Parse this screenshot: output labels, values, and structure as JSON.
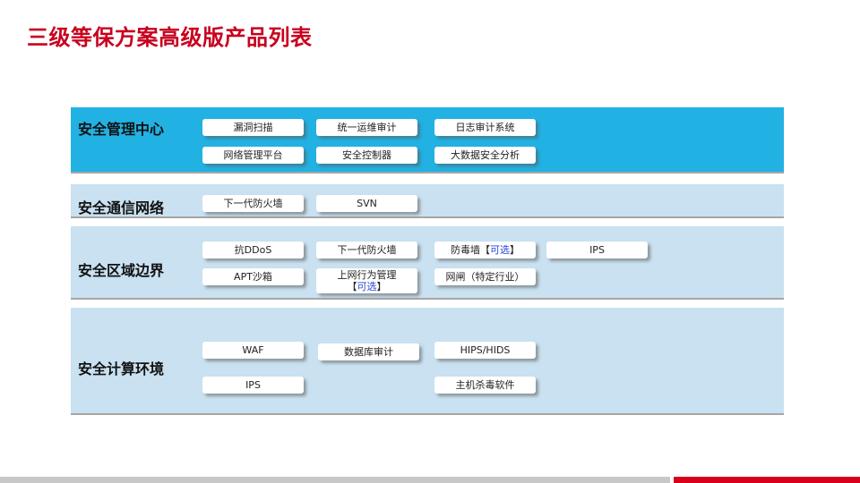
{
  "title": "三级等保方案高级版产品列表",
  "colors": {
    "title": "#c8001e",
    "section_primary": "#22b1e3",
    "section_secondary": "#c9e1f0",
    "optional_text": "#2a45d4",
    "footer_accent": "#d9001b"
  },
  "sections": [
    {
      "label": "安全管理中心",
      "products": [
        "漏洞扫描",
        "统一运维审计",
        "日志审计系统",
        "网络管理平台",
        "安全控制器",
        "大数据安全分析"
      ]
    },
    {
      "label": "安全通信网络",
      "products": [
        "下一代防火墙",
        "SVN"
      ]
    },
    {
      "label": "安全区域边界",
      "products": [
        "抗DDoS",
        "下一代防火墙",
        "防毒墙",
        "IPS",
        "APT沙箱",
        "上网行为管理",
        "网闸（特定行业）"
      ],
      "optional_mark": "可选"
    },
    {
      "label": "安全计算环境",
      "products": [
        "WAF",
        "数据库审计",
        "HIPS/HIDS",
        "IPS",
        "主机杀毒软件"
      ]
    }
  ]
}
